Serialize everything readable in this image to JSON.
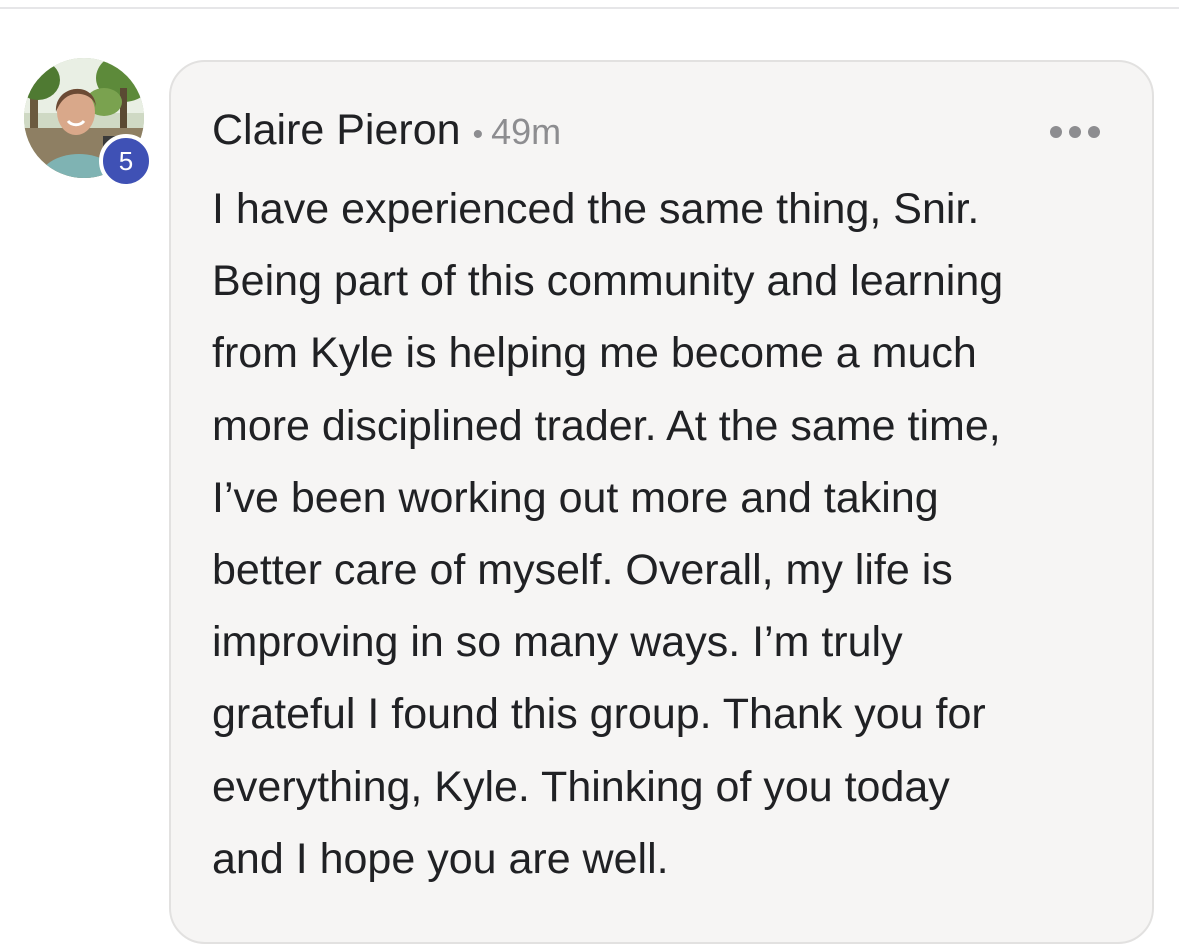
{
  "comment": {
    "author": {
      "name": "Claire Pieron",
      "level": "5",
      "avatar_icon": "profile-photo"
    },
    "separator": "•",
    "timestamp": "49m",
    "more_icon": "more-options-icon",
    "body": "I have experienced the same thing, Snir.\nBeing part of this community and learning\nfrom Kyle is helping me become a much\nmore disciplined trader. At the same time,\nI’ve been working out more and taking\nbetter care of myself. Overall, my life is\nimproving in so many ways. I’m truly\ngrateful I found this group. Thank you for\neverything, Kyle. Thinking of you today\nand I hope you are well."
  },
  "colors": {
    "card_background": "#f6f5f4",
    "badge": "#3f51b5",
    "text": "#202124",
    "muted": "#8d8d90"
  }
}
